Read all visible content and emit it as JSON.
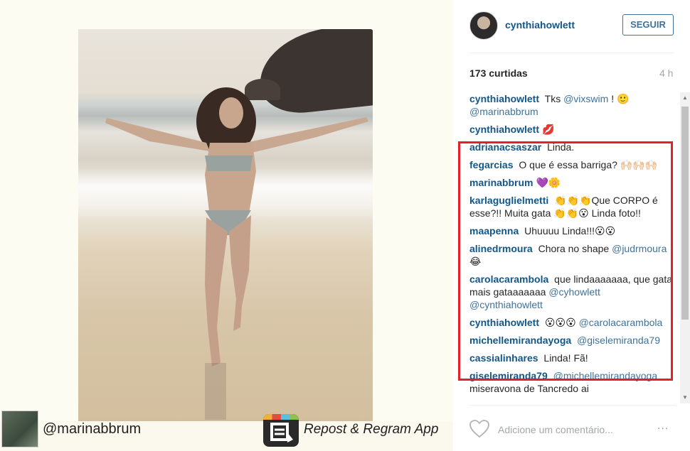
{
  "post": {
    "author": "cynthiahowlett",
    "follow_label": "SEGUIR",
    "likes": "173 curtidas",
    "time": "4 h",
    "comment_placeholder": "Adicione um comentário...",
    "more_label": "..."
  },
  "comments": [
    {
      "user": "cynthiahowlett",
      "text": " Tks ",
      "mention": "@vixswim",
      "tail": " ! 🙂 ",
      "mention2": "@marinabbrum"
    },
    {
      "user": "cynthiahowlett",
      "text": "💋",
      "mention": "",
      "tail": "",
      "mention2": ""
    },
    {
      "user": "adrianacsaszar",
      "text": " Linda.",
      "mention": "",
      "tail": "",
      "mention2": ""
    },
    {
      "user": "fegarcias",
      "text": " O que é essa barriga? 🙌🏻🙌🏻🙌🏻",
      "mention": "",
      "tail": "",
      "mention2": ""
    },
    {
      "user": "marinabbrum",
      "text": "💜🌼",
      "mention": "",
      "tail": "",
      "mention2": ""
    },
    {
      "user": "karlaguglielmetti",
      "text": " 👏👏👏Que CORPO é esse?!! Muita gata 👏👏😮 Linda foto!!",
      "mention": "",
      "tail": "",
      "mention2": ""
    },
    {
      "user": "maapenna",
      "text": " Uhuuuu Linda!!!😮😮",
      "mention": "",
      "tail": "",
      "mention2": ""
    },
    {
      "user": "alinedrmoura",
      "text": " Chora no shape ",
      "mention": "@judrmoura",
      "tail": " 😂",
      "mention2": ""
    },
    {
      "user": "carolacarambola",
      "text": " que lindaaaaaaa, que gata mais gataaaaaaa ",
      "mention": "@cyhowlett",
      "tail": " ",
      "mention2": "@cynthiahowlett"
    },
    {
      "user": "cynthiahowlett",
      "text": " 😮😮😮 ",
      "mention": "@carolacarambola",
      "tail": "",
      "mention2": ""
    },
    {
      "user": "michellemirandayoga",
      "text": " ",
      "mention": "@giselemiranda79",
      "tail": "",
      "mention2": ""
    },
    {
      "user": "cassialinhares",
      "text": " Linda! Fã!",
      "mention": "",
      "tail": "",
      "mention2": ""
    },
    {
      "user": "giselemiranda79",
      "text": " ",
      "mention": "@michellemirandayoga",
      "tail": " miseravona de Tancredo ai",
      "mention2": ""
    }
  ],
  "watermark": {
    "username": "@marinabbrum",
    "app_name": "Repost & Regram App"
  },
  "colors": {
    "link": "#125688",
    "mention": "#3f729b",
    "highlight_border": "#e4202a"
  },
  "icons": [
    "heart-icon",
    "more-icon",
    "scroll-up-icon",
    "scroll-down-icon",
    "repost-app-icon"
  ]
}
